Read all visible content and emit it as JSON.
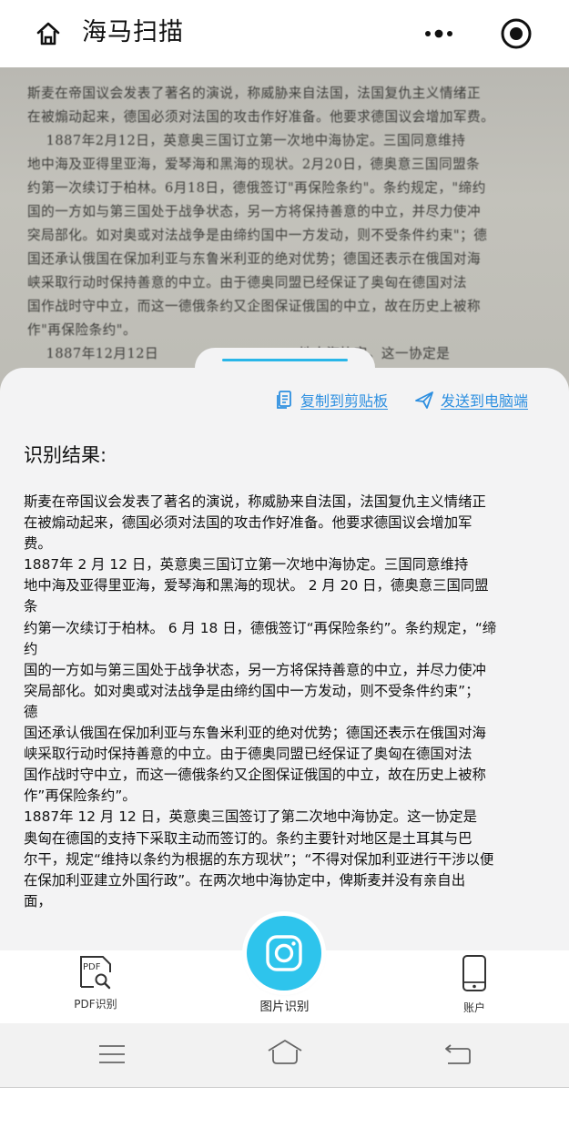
{
  "app": {
    "title": "海马扫描",
    "icons": {
      "home": "home-icon",
      "more": "more-dots-icon",
      "record": "record-circle-icon"
    }
  },
  "photo": {
    "lines": "斯麦在帝国议会发表了著名的演说，称威胁来自法国，法国复仇主义情绪正\n在被煽动起来，德国必须对法国的攻击作好准备。他要求德国议会增加军费。\n    1887年2月12日，英意奥三国订立第一次地中海协定。三国同意维持\n地中海及亚得里亚海，爱琴海和黑海的现状。2月20日，德奥意三国同盟条\n约第一次续订于柏林。6月18日，德俄签订\"再保险条约\"。条约规定，\"缔约\n国的一方如与第三国处于战争状态，另一方将保持善意的中立，并尽力使冲\n突局部化。如对奥或对法战争是由缔约国中一方发动，则不受条件约束\"；德\n国还承认俄国在保加利亚与东鲁米利亚的绝对优势；德国还表示在俄国对海\n峡采取行动时保持善意的中立。由于德奥同盟已经保证了奥匈在德国对法\n国作战时守中立，而这一德俄条约又企图保证俄国的中立，故在历史上被称\n作\"再保险条约\"。\n    1887年12月12日                              地中海协定。这一协定是"
  },
  "actions": {
    "copy_label": "复制到剪贴板",
    "send_label": "发送到电脑端",
    "accent": "#2d8fe0"
  },
  "result": {
    "heading": "识别结果:",
    "text": "斯麦在帝国议会发表了著名的演说，称威胁来自法国，法国复仇主义情绪正\n在被煽动起来，德国必须对法国的攻击作好准备。他要求德国议会增加军\n费。\n1887年 2 月 12 日，英意奥三国订立第一次地中海协定。三国同意维持\n地中海及亚得里亚海，爱琴海和黑海的现状。 2 月 20 日，德奥意三国同盟\n条\n约第一次续订于柏林。 6 月 18 日，德俄签订“再保险条约”。条约规定，“缔\n约\n国的一方如与第三国处于战争状态，另一方将保持善意的中立，并尽力使冲\n突局部化。如对奥或对法战争是由缔约国中一方发动，则不受条件约束”；\n德\n国还承认俄国在保加利亚与东鲁米利亚的绝对优势；德国还表示在俄国对海\n峡采取行动时保持善意的中立。由于德奥同盟已经保证了奥匈在德国对法\n国作战时守中立，而这一德俄条约又企图保证俄国的中立，故在历史上被称\n作”再保险条约”。\n1887年 12 月 12 日，英意奥三国签订了第二次地中海协定。这一协定是\n奥匈在德国的支持下采取主动而签订的。条约主要针对地区是土耳其与巴\n尔干，规定“维持以条约为根据的东方现状”；“不得对保加利亚进行干涉以便\n在保加利亚建立外国行政”。在两次地中海协定中，俾斯麦并没有亲自出\n面，"
  },
  "bottom_nav": {
    "pdf_label": "PDF识别",
    "pdf_icon_text": "PDF",
    "image_label": "图片识别",
    "account_label": "账户",
    "fab_color": "#2ec4ec"
  }
}
